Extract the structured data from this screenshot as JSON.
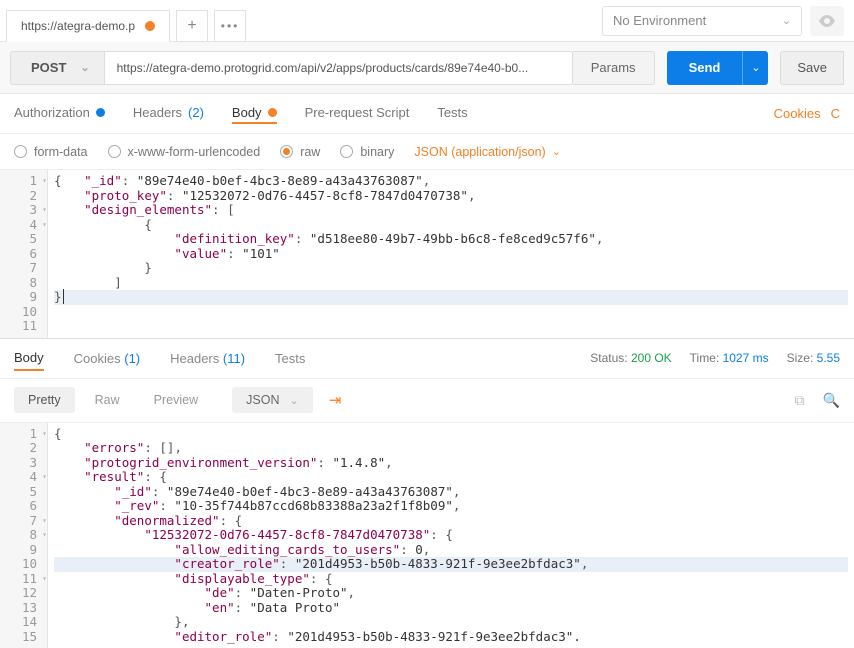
{
  "top": {
    "tab_title": "https://ategra-demo.p",
    "env_label": "No Environment"
  },
  "request": {
    "method": "POST",
    "url": "https://ategra-demo.protogrid.com/api/v2/apps/products/cards/89e74e40-b0...",
    "params_btn": "Params",
    "send_btn": "Send",
    "save_btn": "Save"
  },
  "req_tabs": {
    "auth": "Authorization",
    "headers": "Headers",
    "headers_count": "(2)",
    "body": "Body",
    "prereq": "Pre-request Script",
    "tests": "Tests",
    "cookies": "Cookies",
    "code": "C"
  },
  "body_opts": {
    "formdata": "form-data",
    "urlenc": "x-www-form-urlencoded",
    "raw": "raw",
    "binary": "binary",
    "content_type": "JSON (application/json)"
  },
  "req_body_lines": [
    {
      "n": 1,
      "fold": true,
      "indent": 0,
      "text": "{   \"_id\": \"89e74e40-b0ef-4bc3-8e89-a43a43763087\","
    },
    {
      "n": 2,
      "indent": 1,
      "text": "\"proto_key\": \"12532072-0d76-4457-8cf8-7847d0470738\","
    },
    {
      "n": 3,
      "fold": true,
      "indent": 1,
      "text": "\"design_elements\": ["
    },
    {
      "n": 4,
      "fold": true,
      "indent": 3,
      "text": "{"
    },
    {
      "n": 5,
      "indent": 4,
      "text": "\"definition_key\": \"d518ee80-49b7-49bb-b6c8-fe8ced9c57f6\","
    },
    {
      "n": 6,
      "indent": 4,
      "text": "\"value\": \"101\""
    },
    {
      "n": 7,
      "indent": 3,
      "text": "}"
    },
    {
      "n": 8,
      "indent": 2,
      "text": "]"
    },
    {
      "n": 9,
      "indent": 0,
      "text": "}",
      "cursor": true,
      "hl": true
    },
    {
      "n": 10,
      "indent": 0,
      "text": ""
    },
    {
      "n": 11,
      "indent": 0,
      "text": ""
    }
  ],
  "res_tabs": {
    "body": "Body",
    "cookies": "Cookies",
    "cookies_count": "(1)",
    "headers": "Headers",
    "headers_count": "(11)",
    "tests": "Tests",
    "status_label": "Status:",
    "status": "200 OK",
    "time_label": "Time:",
    "time": "1027 ms",
    "size_label": "Size:",
    "size": "5.55"
  },
  "view": {
    "pretty": "Pretty",
    "raw": "Raw",
    "preview": "Preview",
    "format": "JSON"
  },
  "res_body_lines": [
    {
      "n": 1,
      "fold": true,
      "indent": 0,
      "text": "{"
    },
    {
      "n": 2,
      "indent": 1,
      "text": "\"errors\": [],"
    },
    {
      "n": 3,
      "indent": 1,
      "text": "\"protogrid_environment_version\": \"1.4.8\","
    },
    {
      "n": 4,
      "fold": true,
      "indent": 1,
      "text": "\"result\": {"
    },
    {
      "n": 5,
      "indent": 2,
      "text": "\"_id\": \"89e74e40-b0ef-4bc3-8e89-a43a43763087\","
    },
    {
      "n": 6,
      "indent": 2,
      "text": "\"_rev\": \"10-35f744b87ccd68b83388a23a2f1f8b09\","
    },
    {
      "n": 7,
      "fold": true,
      "indent": 2,
      "text": "\"denormalized\": {"
    },
    {
      "n": 8,
      "fold": true,
      "indent": 3,
      "text": "\"12532072-0d76-4457-8cf8-7847d0470738\": {"
    },
    {
      "n": 9,
      "indent": 4,
      "text": "\"allow_editing_cards_to_users\": 0,"
    },
    {
      "n": 10,
      "indent": 4,
      "hl": true,
      "text": "\"creator_role\": \"201d4953-b50b-4833-921f-9e3ee2bfdac3\","
    },
    {
      "n": 11,
      "fold": true,
      "indent": 4,
      "text": "\"displayable_type\": {"
    },
    {
      "n": 12,
      "indent": 5,
      "text": "\"de\": \"Daten-Proto\","
    },
    {
      "n": 13,
      "indent": 5,
      "text": "\"en\": \"Data Proto\""
    },
    {
      "n": 14,
      "indent": 4,
      "text": "},"
    },
    {
      "n": 15,
      "indent": 4,
      "text": "\"editor_role\": \"201d4953-b50b-4833-921f-9e3ee2bfdac3\"."
    }
  ]
}
